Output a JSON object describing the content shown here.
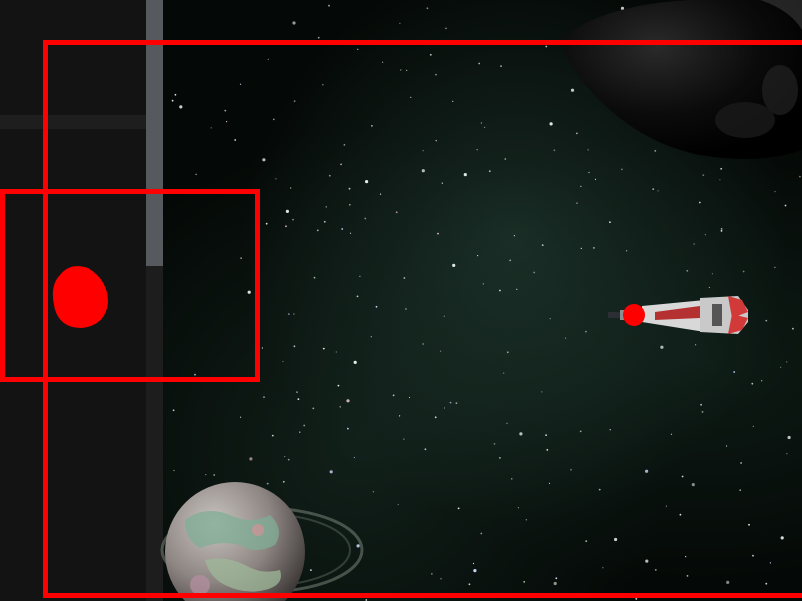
{
  "scene": {
    "description_free": true,
    "objects": {
      "spaceship": "spaceship",
      "planet": "ringed-planet",
      "asteroid": "asteroid"
    },
    "highlight_color": "#ff0000",
    "marker_color": "#ff0000"
  },
  "colors": {
    "panel": "#131313",
    "scrollbar_thumb": "#565a5e",
    "space": "#040806"
  }
}
